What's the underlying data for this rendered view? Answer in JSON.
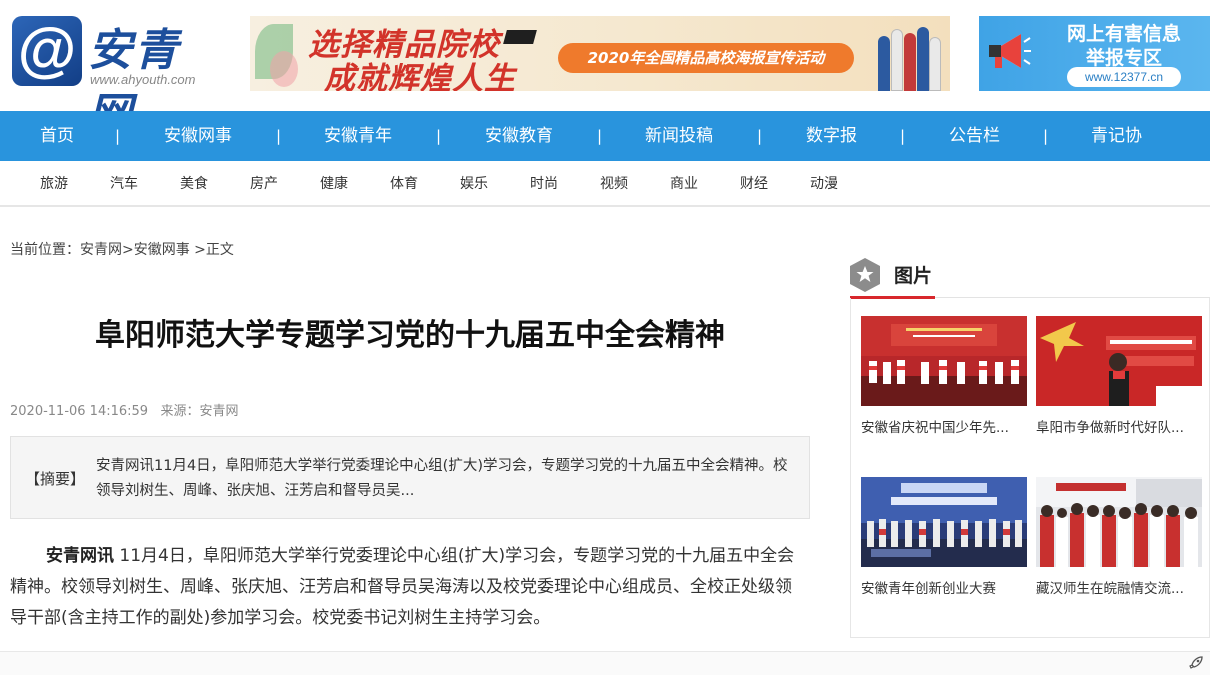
{
  "header": {
    "logo_symbol": "@",
    "logo_name": "安青网",
    "logo_url": "www.ahyouth.com",
    "banner": {
      "line1": "选择精品院校",
      "line2": "成就辉煌人生",
      "pill": "2020年全国精品高校海报宣传活动"
    },
    "report": {
      "line1": "网上有害信息",
      "line2": "举报专区",
      "url": "www.12377.cn",
      "icon": "megaphone-icon"
    }
  },
  "main_nav": {
    "items": [
      "首页",
      "安徽网事",
      "安徽青年",
      "安徽教育",
      "新闻投稿",
      "数字报",
      "公告栏",
      "青记协"
    ],
    "separator": "|",
    "color": "#2994dd"
  },
  "sub_nav": {
    "items": [
      "旅游",
      "汽车",
      "美食",
      "房产",
      "健康",
      "体育",
      "娱乐",
      "时尚",
      "视频",
      "商业",
      "财经",
      "动漫"
    ]
  },
  "breadcrumb": {
    "prefix": "当前位置：",
    "site": "安青网",
    "sep1": ">",
    "section": "安徽网事",
    "sep2": " >",
    "current": "正文"
  },
  "article": {
    "title": "阜阳师范大学专题学习党的十九届五中全会精神",
    "datetime": "2020-11-06 14:16:59",
    "source": "来源：安青网",
    "summary_tag": "【摘要】",
    "summary": "安青网讯11月4日，阜阳师范大学举行党委理论中心组(扩大)学习会，专题学习党的十九届五中全会精神。校领导刘树生、周峰、张庆旭、汪芳启和督导员吴...",
    "lead": "安青网讯",
    "body": " 11月4日，阜阳师范大学举行党委理论中心组(扩大)学习会，专题学习党的十九届五中全会精神。校领导刘树生、周峰、张庆旭、汪芳启和督导员吴海涛以及校党委理论中心组成员、全校正处级领导干部(含主持工作的副处)参加学习会。校党委书记刘树生主持学习会。"
  },
  "sidebar": {
    "title": "图片",
    "accent": "#d8272c",
    "pictures": [
      {
        "caption": "安徽省庆祝中国少年先..."
      },
      {
        "caption": "阜阳市争做新时代好队..."
      },
      {
        "caption": "安徽青年创新创业大赛"
      },
      {
        "caption": "藏汉师生在皖融情交流..."
      }
    ]
  }
}
